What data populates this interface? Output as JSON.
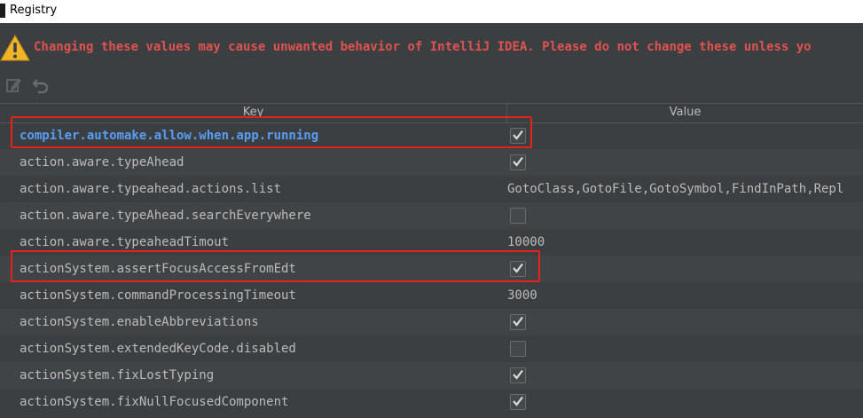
{
  "window": {
    "title": "Registry"
  },
  "warning": {
    "message": "Changing these values may cause unwanted behavior of IntelliJ IDEA. Please do not change these unless yo",
    "color": "#e0524f"
  },
  "toolbar": {
    "edit_icon": "edit-icon",
    "revert_icon": "revert-icon"
  },
  "table": {
    "headers": {
      "key": "Key",
      "value": "Value"
    },
    "rows": [
      {
        "key": "compiler.automake.allow.when.app.running",
        "type": "bool",
        "checked": true,
        "modified": true
      },
      {
        "key": "action.aware.typeAhead",
        "type": "bool",
        "checked": true
      },
      {
        "key": "action.aware.typeahead.actions.list",
        "type": "text",
        "value": "GotoClass,GotoFile,GotoSymbol,FindInPath,Repl"
      },
      {
        "key": "action.aware.typeAhead.searchEverywhere",
        "type": "bool",
        "checked": false
      },
      {
        "key": "action.aware.typeaheadTimout",
        "type": "text",
        "value": "10000"
      },
      {
        "key": "actionSystem.assertFocusAccessFromEdt",
        "type": "bool",
        "checked": true
      },
      {
        "key": "actionSystem.commandProcessingTimeout",
        "type": "text",
        "value": "3000"
      },
      {
        "key": "actionSystem.enableAbbreviations",
        "type": "bool",
        "checked": true
      },
      {
        "key": "actionSystem.extendedKeyCode.disabled",
        "type": "bool",
        "checked": false
      },
      {
        "key": "actionSystem.fixLostTyping",
        "type": "bool",
        "checked": true
      },
      {
        "key": "actionSystem.fixNullFocusedComponent",
        "type": "bool",
        "checked": true
      }
    ]
  },
  "colors": {
    "background": "#3c3f41",
    "modified_key": "#589df6",
    "highlight_box": "#e8211a"
  }
}
